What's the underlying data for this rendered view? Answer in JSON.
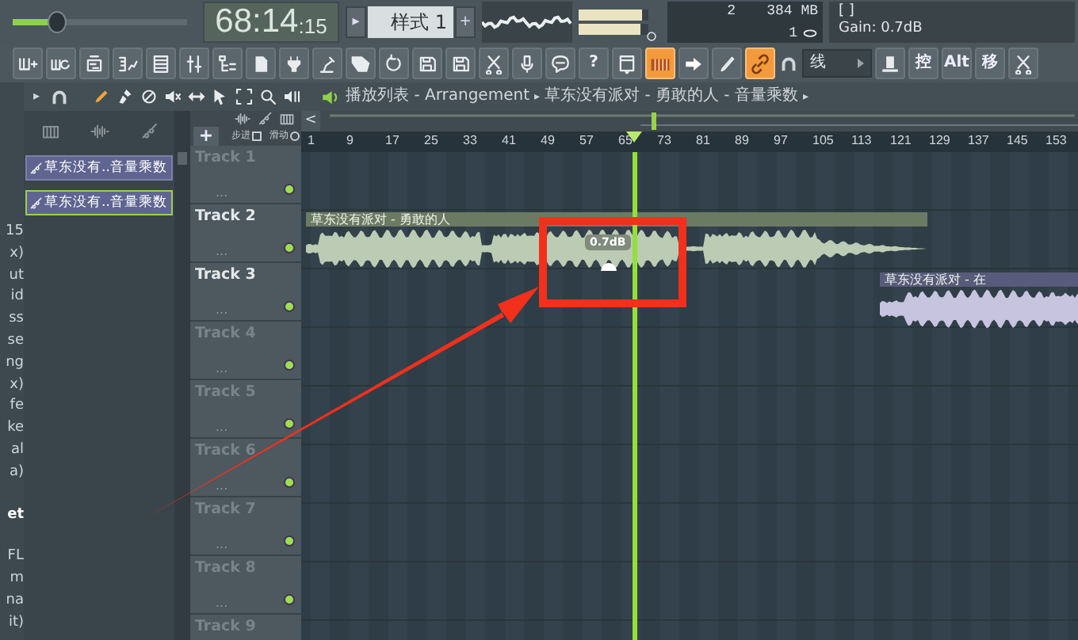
{
  "top_bar": {
    "master_volume": {
      "level": 0.25
    },
    "time": {
      "main": "68:14",
      "sub": ":15"
    },
    "pattern": {
      "prev": "▸",
      "label": "样式 1",
      "add": "+"
    },
    "meters": [
      {
        "level": 0.92
      },
      {
        "level": 0.88
      }
    ],
    "cpu": {
      "count": "2",
      "memory": "384 MB",
      "polyphony": "1"
    },
    "hint": {
      "brackets": "[ ]",
      "text": "Gain:  0.7dB"
    }
  },
  "toolbar": [
    {
      "kind": "icon",
      "on": false
    },
    {
      "kind": "icon",
      "on": false
    },
    {
      "kind": "icon",
      "on": false
    },
    {
      "kind": "icon",
      "on": false
    },
    {
      "kind": "icon",
      "on": false
    },
    {
      "kind": "icon",
      "on": false
    },
    {
      "kind": "icon",
      "on": false
    },
    {
      "kind": "icon",
      "on": false
    },
    {
      "kind": "icon",
      "on": false
    },
    {
      "kind": "icon",
      "on": false
    },
    {
      "kind": "icon",
      "on": false
    },
    {
      "kind": "icon",
      "on": false
    },
    {
      "kind": "icon",
      "on": false
    },
    {
      "kind": "icon",
      "on": false
    },
    {
      "kind": "icon",
      "on": false
    },
    {
      "kind": "icon",
      "on": false
    },
    {
      "kind": "icon",
      "on": false
    },
    {
      "kind": "text",
      "text": "?",
      "on": false
    },
    {
      "kind": "icon",
      "on": false
    },
    {
      "kind": "icon",
      "on": true
    },
    {
      "kind": "icon",
      "on": false
    },
    {
      "kind": "icon",
      "on": false
    },
    {
      "kind": "icon",
      "on": true
    },
    {
      "kind": "plain"
    },
    {
      "kind": "dropdown",
      "text": "线"
    },
    {
      "kind": "icon",
      "on": false
    },
    {
      "kind": "text",
      "text": "控",
      "on": false
    },
    {
      "kind": "text",
      "text": "Alt",
      "on": false
    },
    {
      "kind": "text",
      "text": "移",
      "on": false
    },
    {
      "kind": "icon",
      "on": false
    }
  ],
  "side_column": [
    {
      "text": "15",
      "kind": "line"
    },
    {
      "text": "x)",
      "kind": "line"
    },
    {
      "text": "ut",
      "kind": "line"
    },
    {
      "text": "id",
      "kind": "line"
    },
    {
      "text": "ss",
      "kind": "line"
    },
    {
      "text": "se",
      "kind": "line"
    },
    {
      "text": "ng",
      "kind": "line"
    },
    {
      "text": "x)",
      "kind": "line"
    },
    {
      "text": "fe",
      "kind": "line"
    },
    {
      "text": "ke",
      "kind": "line"
    },
    {
      "text": "al",
      "kind": "line"
    },
    {
      "text": "a)",
      "kind": "line"
    },
    {
      "text": "et",
      "kind": "heading"
    },
    {
      "text": "FL",
      "kind": "line"
    },
    {
      "text": "m",
      "kind": "line"
    },
    {
      "text": "na",
      "kind": "line"
    },
    {
      "text": "it)",
      "kind": "line"
    }
  ],
  "playlist": {
    "menu_arrow": "▸",
    "title": "播放列表 - Arrangement",
    "crumb_separator": "▸",
    "path": "草东没有派对 - 勇敢的人 - 音量乘数",
    "crumb_end": "▸",
    "browser_items": [
      {
        "text": "草东没有..音量乘数",
        "selected": false
      },
      {
        "text": "草东没有..音量乘数",
        "selected": true
      }
    ],
    "header": {
      "add": "+",
      "step_label": "步进",
      "slide_label": "滑动"
    },
    "scroll_left": "<",
    "ruler": [
      "1",
      "9",
      "17",
      "25",
      "33",
      "41",
      "49",
      "57",
      "65",
      "73",
      "81",
      "89",
      "97",
      "105",
      "113",
      "121",
      "129",
      "137",
      "145",
      "153"
    ],
    "tracks": [
      {
        "name": "Track 1",
        "dimmed": true,
        "menu": "...",
        "enabled": true
      },
      {
        "name": "Track 2",
        "dimmed": false,
        "menu": "...",
        "enabled": true,
        "clips": [
          {
            "title": "草东没有派对 - 勇敢的人",
            "color": "#6b7a63",
            "gain": "0.7dB"
          }
        ]
      },
      {
        "name": "Track 3",
        "dimmed": false,
        "menu": "...",
        "enabled": true,
        "clips": [
          {
            "title": "草东没有派对 - 在",
            "color": "#585b7a"
          }
        ]
      },
      {
        "name": "Track 4",
        "dimmed": true,
        "menu": "...",
        "enabled": true
      },
      {
        "name": "Track 5",
        "dimmed": true,
        "menu": "...",
        "enabled": true
      },
      {
        "name": "Track 6",
        "dimmed": true,
        "menu": "...",
        "enabled": true
      },
      {
        "name": "Track 7",
        "dimmed": true,
        "menu": "...",
        "enabled": true
      },
      {
        "name": "Track 8",
        "dimmed": true,
        "menu": "...",
        "enabled": true
      },
      {
        "name": "Track 9",
        "dimmed": true
      }
    ]
  }
}
